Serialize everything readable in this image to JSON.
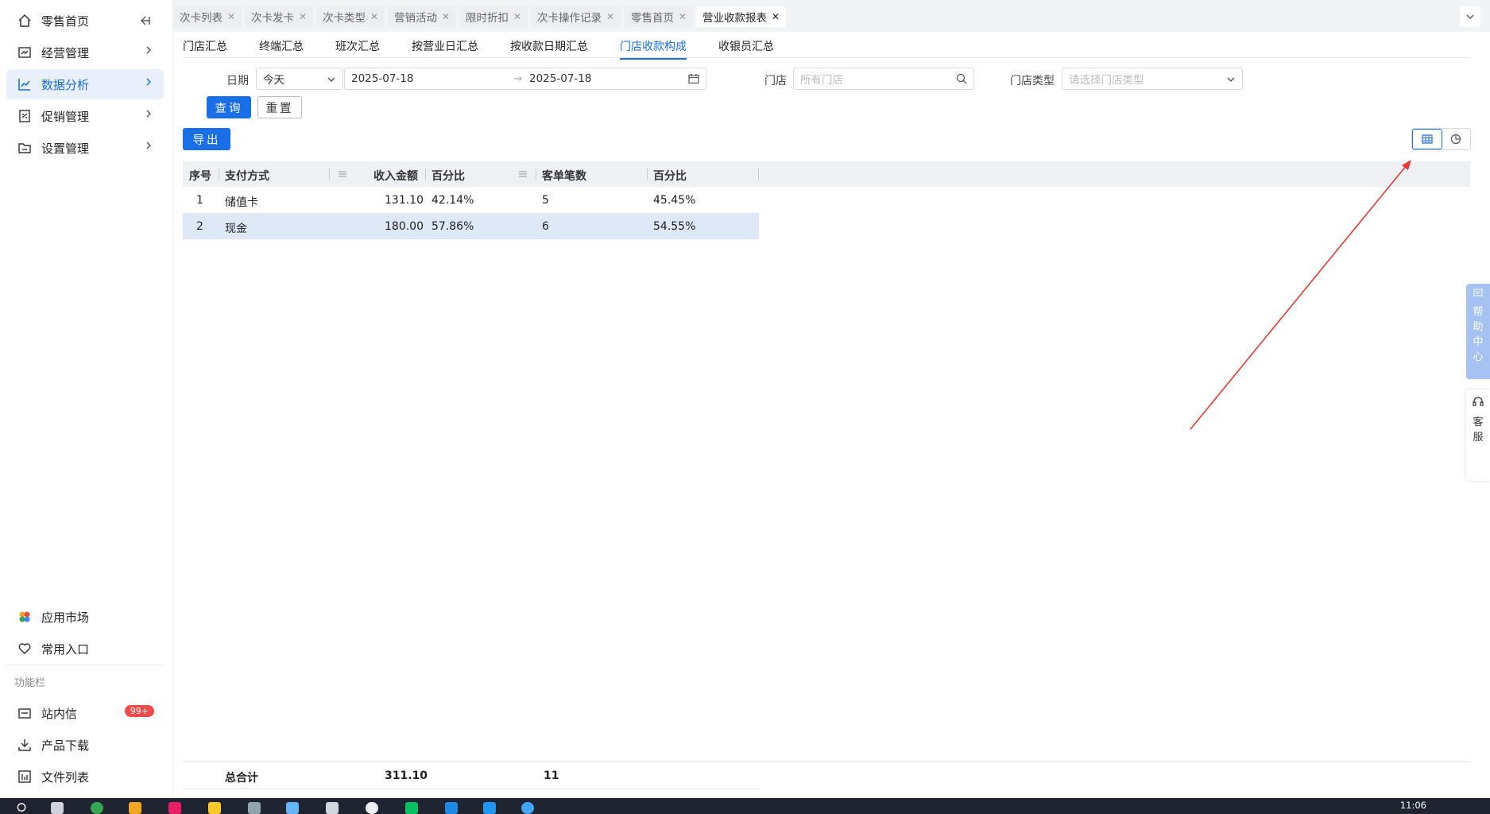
{
  "sidebar": {
    "collapse_icon": "collapse-left-icon",
    "items": [
      {
        "label": "零售首页",
        "icon": "home-icon"
      },
      {
        "label": "经营管理",
        "icon": "chart-box-icon"
      },
      {
        "label": "数据分析",
        "icon": "line-chart-icon"
      },
      {
        "label": "促销管理",
        "icon": "promo-icon"
      },
      {
        "label": "设置管理",
        "icon": "settings-folder-icon"
      }
    ],
    "bottom": [
      {
        "label": "应用市场",
        "icon": "app-market-icon"
      },
      {
        "label": "常用入口",
        "icon": "heart-icon"
      }
    ],
    "section_title": "功能栏",
    "tools": [
      {
        "label": "站内信",
        "icon": "mail-icon",
        "badge": "99+"
      },
      {
        "label": "产品下载",
        "icon": "download-icon"
      },
      {
        "label": "文件列表",
        "icon": "file-list-icon"
      }
    ]
  },
  "tabs": [
    {
      "label": "次卡列表"
    },
    {
      "label": "次卡发卡"
    },
    {
      "label": "次卡类型"
    },
    {
      "label": "营销活动"
    },
    {
      "label": "限时折扣"
    },
    {
      "label": "次卡操作记录"
    },
    {
      "label": "零售首页"
    },
    {
      "label": "营业收款报表"
    }
  ],
  "subnav": [
    "门店汇总",
    "终端汇总",
    "班次汇总",
    "按营业日汇总",
    "按收款日期汇总",
    "门店收款构成",
    "收银员汇总"
  ],
  "filters": {
    "date_label": "日期",
    "date_preset": "今天",
    "date_start": "2025-07-18",
    "date_arrow": "→",
    "date_end": "2025-07-18",
    "store_label": "门店",
    "store_placeholder": "所有门店",
    "store_type_label": "门店类型",
    "store_type_placeholder": "请选择门店类型",
    "query_button": "查询",
    "reset_button": "重置",
    "export_button": "导出"
  },
  "table": {
    "headers": [
      "序号",
      "支付方式",
      "收入金额",
      "百分比",
      "客单笔数",
      "百分比"
    ],
    "rows": [
      [
        "1",
        "储值卡",
        "131.10",
        "42.14%",
        "5",
        "45.45%"
      ],
      [
        "2",
        "现金",
        "180.00",
        "57.86%",
        "6",
        "54.55%"
      ]
    ],
    "footer": {
      "label": "总合计",
      "amount": "311.10",
      "count": "11"
    }
  },
  "help": {
    "label": "帮助中心",
    "chars": [
      "帮",
      "助",
      "中",
      "心"
    ]
  },
  "service": {
    "chars": [
      "客",
      "服"
    ]
  },
  "taskbar": {
    "time": "11:06"
  },
  "colors": {
    "accent": "#1a6ee6",
    "annotation_arrow": "#e53935",
    "badge": "#f04a4a"
  }
}
